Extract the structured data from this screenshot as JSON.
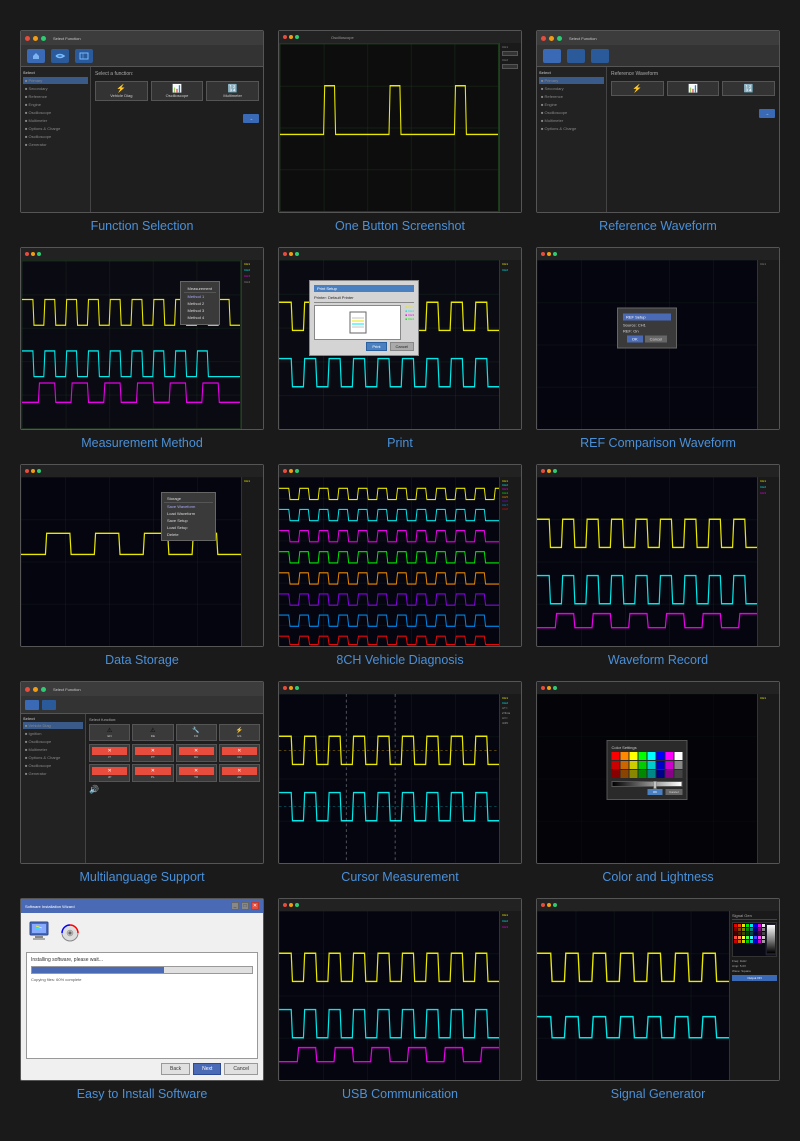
{
  "page": {
    "background": "#1a1a1a"
  },
  "cards": [
    {
      "id": "function-selection",
      "label": "Function Selection",
      "type": "app-ui",
      "description": "App interface with sidebar menu and function icons"
    },
    {
      "id": "one-button-screenshot",
      "label": "One Button Screenshot",
      "type": "oscilloscope-dark",
      "description": "Dark oscilloscope with yellow trace"
    },
    {
      "id": "reference-waveform",
      "label": "Reference Waveform",
      "type": "app-ui-ref",
      "description": "App interface similar to function selection"
    },
    {
      "id": "measurement-method",
      "label": "Measurement Method",
      "type": "oscilloscope-multi",
      "description": "Oscilloscope with multiple colored waveforms and menu"
    },
    {
      "id": "print",
      "label": "Print",
      "type": "oscilloscope-print",
      "description": "Oscilloscope with print dialog"
    },
    {
      "id": "ref-comparison",
      "label": "REF Comparison Waveform",
      "type": "oscilloscope-ref-comp",
      "description": "Dark oscilloscope with small dialog"
    },
    {
      "id": "data-storage",
      "label": "Data Storage",
      "type": "oscilloscope-storage",
      "description": "Dark oscilloscope with storage menu"
    },
    {
      "id": "8ch-vehicle",
      "label": "8CH Vehicle Diagnosis",
      "type": "oscilloscope-8ch",
      "description": "8 channel oscilloscope display"
    },
    {
      "id": "waveform-record",
      "label": "Waveform Record",
      "type": "oscilloscope-record",
      "description": "Oscilloscope waveform record view"
    },
    {
      "id": "multilanguage",
      "label": "Multilanguage Support",
      "type": "app-multilang",
      "description": "App with language icons"
    },
    {
      "id": "cursor-measurement",
      "label": "Cursor Measurement",
      "type": "oscilloscope-cursor",
      "description": "Oscilloscope with cursor lines"
    },
    {
      "id": "color-lightness",
      "label": "Color and Lightness",
      "type": "oscilloscope-color",
      "description": "Dark oscilloscope with color palette"
    },
    {
      "id": "easy-install",
      "label": "Easy to Install Software",
      "type": "install-software",
      "description": "Software installation dialog"
    },
    {
      "id": "usb-communication",
      "label": "USB Communication",
      "type": "oscilloscope-usb",
      "description": "Oscilloscope with USB waveforms"
    },
    {
      "id": "signal-generator",
      "label": "Signal Generator",
      "type": "oscilloscope-signal-gen",
      "description": "Oscilloscope with signal generator panel"
    }
  ]
}
